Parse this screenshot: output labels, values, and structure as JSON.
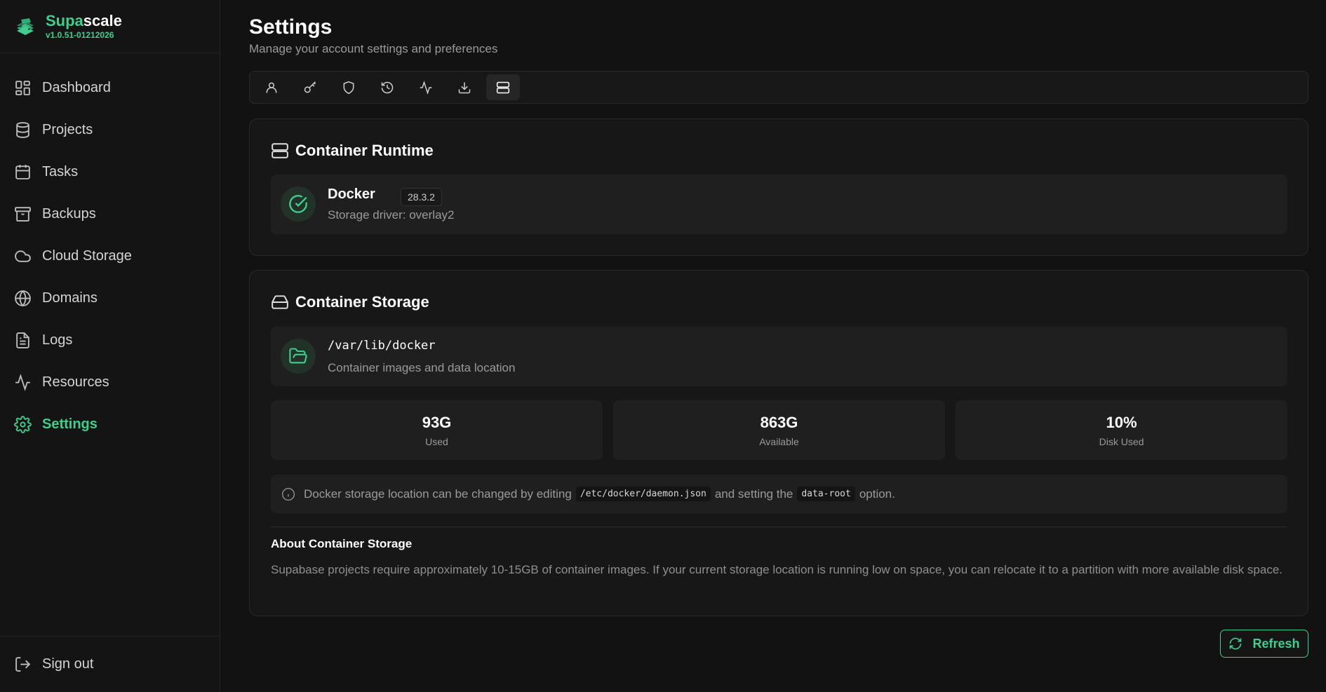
{
  "brand": {
    "name_accent": "Supa",
    "name_rest": "scale",
    "version": "v1.0.51-01212026",
    "logo_icon": "layered-stack-logo-icon",
    "accent_color": "#3ecf8e"
  },
  "sidebar": {
    "items": [
      {
        "label": "Dashboard",
        "icon": "dashboard-grid-icon"
      },
      {
        "label": "Projects",
        "icon": "database-icon"
      },
      {
        "label": "Tasks",
        "icon": "calendar-icon"
      },
      {
        "label": "Backups",
        "icon": "archive-icon"
      },
      {
        "label": "Cloud Storage",
        "icon": "cloud-icon"
      },
      {
        "label": "Domains",
        "icon": "globe-icon"
      },
      {
        "label": "Logs",
        "icon": "file-text-icon"
      },
      {
        "label": "Resources",
        "icon": "activity-icon"
      },
      {
        "label": "Settings",
        "icon": "gear-icon",
        "active": true
      }
    ],
    "signout": {
      "label": "Sign out",
      "icon": "log-out-icon"
    }
  },
  "header": {
    "title": "Settings",
    "subtitle": "Manage your account settings and preferences"
  },
  "tabs": [
    {
      "icon": "user-icon"
    },
    {
      "icon": "key-icon"
    },
    {
      "icon": "shield-icon"
    },
    {
      "icon": "history-icon"
    },
    {
      "icon": "activity-icon"
    },
    {
      "icon": "download-icon"
    },
    {
      "icon": "server-icon",
      "active": true
    }
  ],
  "runtime": {
    "title": "Container Runtime",
    "name": "Docker",
    "version": "28.3.2",
    "storage_driver": "Storage driver: overlay2"
  },
  "storage": {
    "title": "Container Storage",
    "path": "/var/lib/docker",
    "path_desc": "Container images and data location",
    "stats": [
      {
        "value": "93G",
        "label": "Used"
      },
      {
        "value": "863G",
        "label": "Available"
      },
      {
        "value": "10%",
        "label": "Disk Used"
      }
    ],
    "info": {
      "text_before": "Docker storage location can be changed by editing",
      "code1": "/etc/docker/daemon.json",
      "text_mid": "and setting the",
      "code2": "data-root",
      "text_after": "option."
    },
    "about_title": "About Container Storage",
    "about_text": "Supabase projects require approximately 10-15GB of container images. If your current storage location is running low on space, you can relocate it to a partition with more available disk space."
  },
  "refresh_label": "Refresh"
}
